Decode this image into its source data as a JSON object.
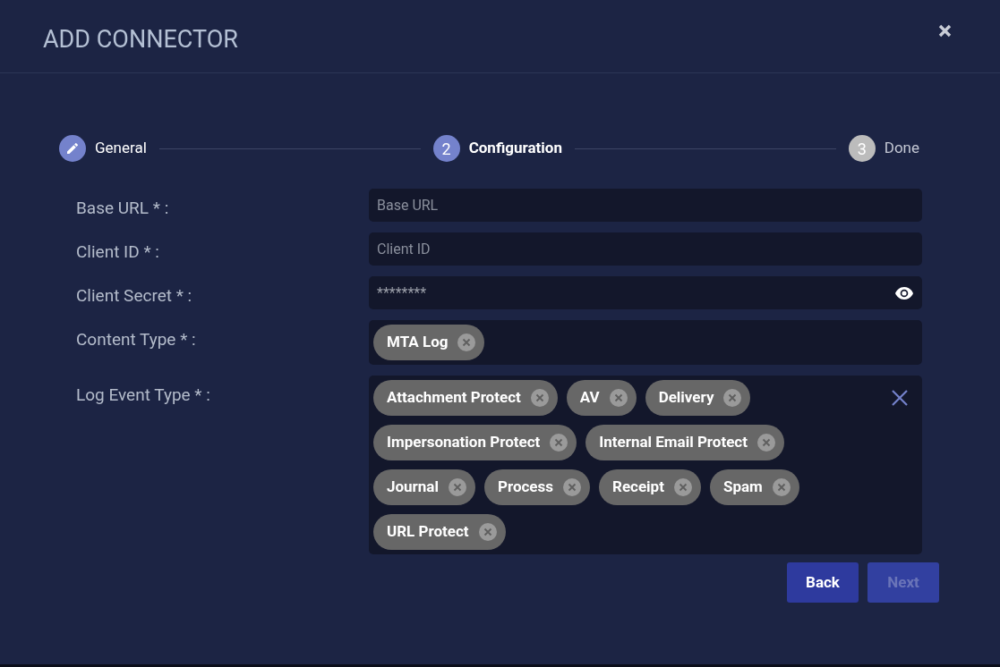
{
  "dialog": {
    "title": "ADD CONNECTOR"
  },
  "steps": [
    {
      "label": "General",
      "completed": true,
      "selected": false
    },
    {
      "label": "Configuration",
      "number": "2",
      "completed": false,
      "selected": true
    },
    {
      "label": "Done",
      "number": "3",
      "completed": false,
      "selected": false
    }
  ],
  "fields": [
    {
      "kind": "text",
      "label": "Base URL * :",
      "placeholder": "Base URL"
    },
    {
      "kind": "text",
      "label": "Client ID * :",
      "placeholder": "Client ID"
    },
    {
      "kind": "password",
      "label": "Client Secret * :",
      "value": "********"
    },
    {
      "kind": "chips",
      "label": "Content Type * :",
      "clearable": false,
      "chips": [
        "MTA Log"
      ]
    },
    {
      "kind": "chips",
      "label": "Log Event Type * :",
      "clearable": true,
      "chips": [
        "Attachment Protect",
        "AV",
        "Delivery",
        "Impersonation Protect",
        "Internal Email Protect",
        "Journal",
        "Process",
        "Receipt",
        "Spam",
        "URL Protect"
      ]
    }
  ],
  "buttons": [
    {
      "label": "Back",
      "disabled": false
    },
    {
      "label": "Next",
      "disabled": true
    }
  ]
}
